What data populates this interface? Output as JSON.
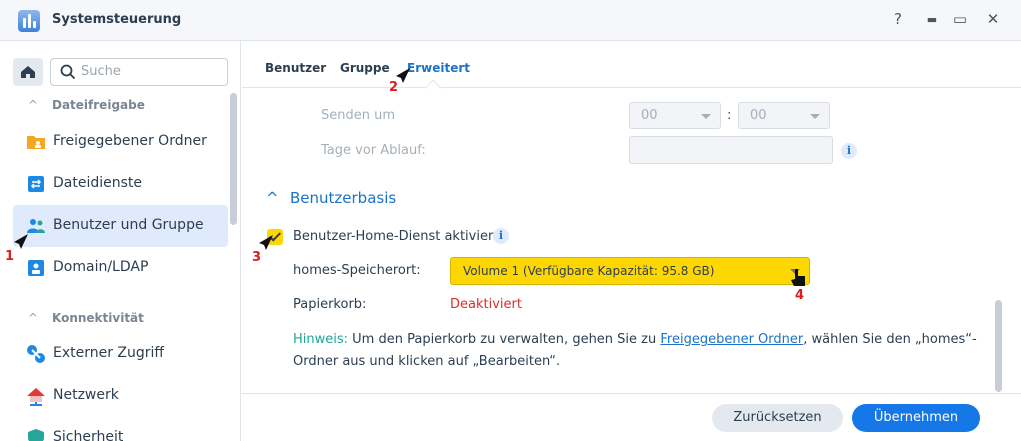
{
  "window": {
    "title": "Systemsteuerung",
    "help": "?",
    "minimize": "▬",
    "maximize": "▭",
    "close": "✕"
  },
  "search": {
    "placeholder": "Suche"
  },
  "sidebar": {
    "section1": "Dateifreigabe",
    "items": [
      {
        "label": "Freigegebener Ordner"
      },
      {
        "label": "Dateidienste"
      },
      {
        "label": "Benutzer und Gruppe"
      },
      {
        "label": "Domain/LDAP"
      }
    ],
    "section2": "Konnektivität",
    "items2": [
      {
        "label": "Externer Zugriff"
      },
      {
        "label": "Netzwerk"
      },
      {
        "label": "Sicherheit"
      }
    ]
  },
  "tabs": [
    {
      "label": "Benutzer"
    },
    {
      "label": "Gruppe"
    },
    {
      "label": "Erweitert"
    }
  ],
  "form": {
    "send_at": "Senden um",
    "hour": "00",
    "minute": "00",
    "colon": ":",
    "days_before": "Tage vor Ablauf:",
    "info": "i",
    "group_title": "Benutzerbasis",
    "home_service": "Benutzer-Home-Dienst aktivieren",
    "homes_location": "homes-Speicherort:",
    "volume": "Volume 1 (Verfügbare Kapazität:  95.8 GB)",
    "recycle_bin": "Papierkorb:",
    "recycle_status": "Deaktiviert",
    "hint_key": "Hinweis:",
    "hint_pre": " Um den Papierkorb zu verwalten, gehen Sie zu ",
    "hint_link": "Freigegebener Ordner",
    "hint_post": ", wählen Sie den „homes“-Ordner aus und klicken auf „Bearbeiten“."
  },
  "footer": {
    "reset": "Zurücksetzen",
    "apply": "Übernehmen"
  },
  "annotations": [
    "1",
    "2",
    "3",
    "4"
  ],
  "colors": {
    "accent": "#1a73c9",
    "highlight": "#ffd700",
    "danger": "#d62f2f",
    "hint": "#1fa69b"
  }
}
